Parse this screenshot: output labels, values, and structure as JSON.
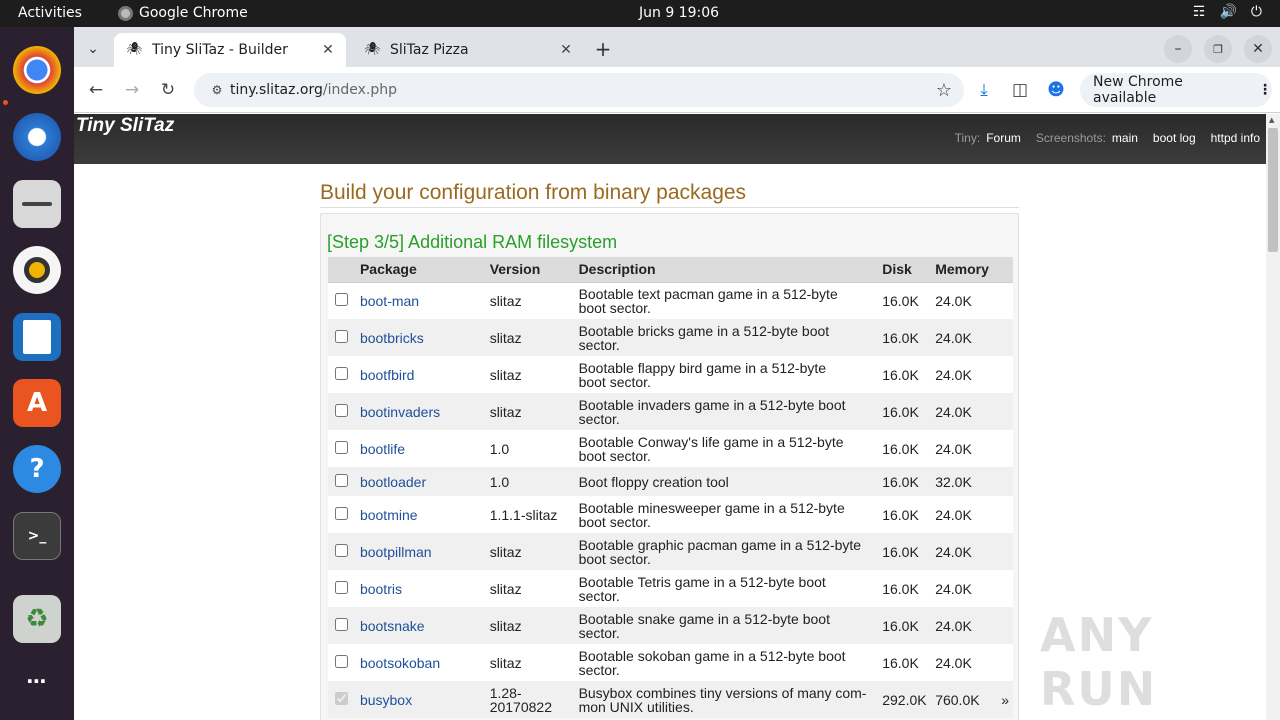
{
  "system": {
    "activities": "Activities",
    "app_name": "Google Chrome",
    "clock": "Jun 9  19:06"
  },
  "browser": {
    "tabs": [
      {
        "title": "Tiny SliTaz - Builder",
        "active": true
      },
      {
        "title": "SliTaz Pizza",
        "active": false
      }
    ],
    "url_host": "tiny.slitaz.org",
    "url_path": "/index.php",
    "new_chrome": "New Chrome available"
  },
  "site": {
    "logo": "Tiny SliTaz",
    "nav": {
      "tiny": "Tiny:",
      "forum": "Forum",
      "screenshots": "Screenshots:",
      "main": "main",
      "boot_log": "boot log",
      "httpd_info": "httpd info"
    }
  },
  "builder": {
    "heading": "Build your configuration from binary packages",
    "step": "[Step 3/5] Additional RAM filesystem",
    "columns": {
      "package": "Package",
      "version": "Version",
      "description": "Description",
      "disk": "Disk",
      "memory": "Memory"
    },
    "packages": [
      {
        "name": "boot-man",
        "version": "slitaz",
        "desc1": "Bootable text pacman game in a 512-byte",
        "desc2": "boot sector.",
        "disk": "16.0K",
        "memory": "24.0K",
        "checked": false,
        "disabled": false
      },
      {
        "name": "bootbricks",
        "version": "slitaz",
        "desc1": "Bootable bricks game in a 512-byte boot",
        "desc2": "sector.",
        "disk": "16.0K",
        "memory": "24.0K",
        "checked": false,
        "disabled": false
      },
      {
        "name": "bootfbird",
        "version": "slitaz",
        "desc1": "Bootable flappy bird game in a 512-byte",
        "desc2": "boot sector.",
        "disk": "16.0K",
        "memory": "24.0K",
        "checked": false,
        "disabled": false
      },
      {
        "name": "bootinvaders",
        "version": "slitaz",
        "desc1": "Bootable invaders game in a 512-byte boot",
        "desc2": "sector.",
        "disk": "16.0K",
        "memory": "24.0K",
        "checked": false,
        "disabled": false
      },
      {
        "name": "bootlife",
        "version": "1.0",
        "desc1": "Bootable Conway's life game in a 512-byte",
        "desc2": "boot sector.",
        "disk": "16.0K",
        "memory": "24.0K",
        "checked": false,
        "disabled": false
      },
      {
        "name": "bootloader",
        "version": "1.0",
        "desc1": "Boot floppy creation tool",
        "desc2": "",
        "disk": "16.0K",
        "memory": "32.0K",
        "checked": false,
        "disabled": false
      },
      {
        "name": "bootmine",
        "version": "1.1.1-slitaz",
        "desc1": "Bootable minesweeper game in a 512-byte",
        "desc2": "boot sector.",
        "disk": "16.0K",
        "memory": "24.0K",
        "checked": false,
        "disabled": false
      },
      {
        "name": "bootpillman",
        "version": "slitaz",
        "desc1": "Bootable graphic pacman game in a 512-byte",
        "desc2": "boot sector.",
        "disk": "16.0K",
        "memory": "24.0K",
        "checked": false,
        "disabled": false
      },
      {
        "name": "bootris",
        "version": "slitaz",
        "desc1": "Bootable Tetris game in a 512-byte boot",
        "desc2": "sector.",
        "disk": "16.0K",
        "memory": "24.0K",
        "checked": false,
        "disabled": false
      },
      {
        "name": "bootsnake",
        "version": "slitaz",
        "desc1": "Bootable snake game in a 512-byte boot",
        "desc2": "sector.",
        "disk": "16.0K",
        "memory": "24.0K",
        "checked": false,
        "disabled": false
      },
      {
        "name": "bootsokoban",
        "version": "slitaz",
        "desc1": "Bootable sokoban game in a 512-byte boot",
        "desc2": "sector.",
        "disk": "16.0K",
        "memory": "24.0K",
        "checked": false,
        "disabled": false
      },
      {
        "name": "busybox",
        "version": "1.28-\n20170822",
        "desc1": "Busybox combines tiny versions of many com-",
        "desc2": "mon UNIX utilities.",
        "disk": "292.0K",
        "memory": "760.0K",
        "checked": true,
        "disabled": true,
        "more": "»"
      }
    ]
  },
  "watermark": "ANY RUN"
}
